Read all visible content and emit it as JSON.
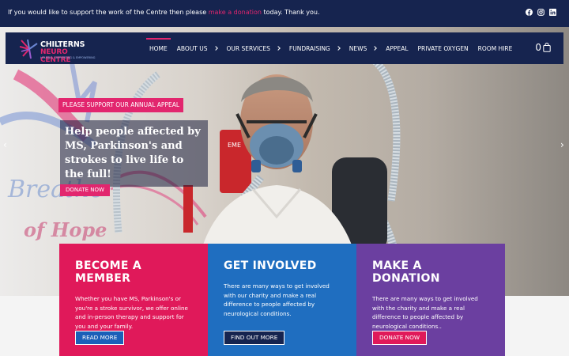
{
  "topbar": {
    "message_before": "If you would like to support the work of the Centre then please",
    "message_link": "make a donation",
    "message_after": "today. Thank you.",
    "social_icons": [
      "facebook-icon",
      "instagram-icon",
      "linkedin-icon"
    ]
  },
  "logo": {
    "line1": "CHILTERNS",
    "line2": "NEURO CENTRE",
    "tagline": "HELPING, SUPPORTING & EMPOWERING"
  },
  "nav": {
    "items": [
      {
        "label": "HOME",
        "has_dropdown": false
      },
      {
        "label": "ABOUT US",
        "has_dropdown": true
      },
      {
        "label": "OUR SERVICES",
        "has_dropdown": true
      },
      {
        "label": "FUNDRAISING",
        "has_dropdown": true
      },
      {
        "label": "NEWS",
        "has_dropdown": true
      },
      {
        "label": "APPEAL",
        "has_dropdown": false
      },
      {
        "label": "PRIVATE OXYGEN",
        "has_dropdown": false
      },
      {
        "label": "ROOM HIRE",
        "has_dropdown": false
      }
    ],
    "cart_count": "0"
  },
  "hero": {
    "tag": "PLEASE SUPPORT OUR ANNUAL APPEAL",
    "title": "Help people affected by MS, Parkinson's and strokes to live life to the full!",
    "button": "DONATE NOW",
    "script_text_1": "Breathe",
    "script_text_2": "of Hope",
    "cylinder_label": "EME"
  },
  "cards": [
    {
      "title": "BECOME A MEMBER",
      "text": "Whether you have MS, Parkinson's or you're a stroke survivor, we offer online and in-person therapy and support for you and your family.",
      "button": "READ MORE"
    },
    {
      "title": "GET INVOLVED",
      "text": "There are many ways to get involved with our charity and make a real difference to people affected by neurological conditions.",
      "button": "FIND OUT MORE"
    },
    {
      "title": "MAKE A DONATION",
      "text": "There are many ways to get involved with the charity and make a real difference to people affected by neurological conditions..",
      "button": "DONATE NOW"
    }
  ],
  "colors": {
    "navy": "#16244f",
    "pink": "#e2266e",
    "blue": "#1f6ec0",
    "purple": "#6b3fa0"
  }
}
